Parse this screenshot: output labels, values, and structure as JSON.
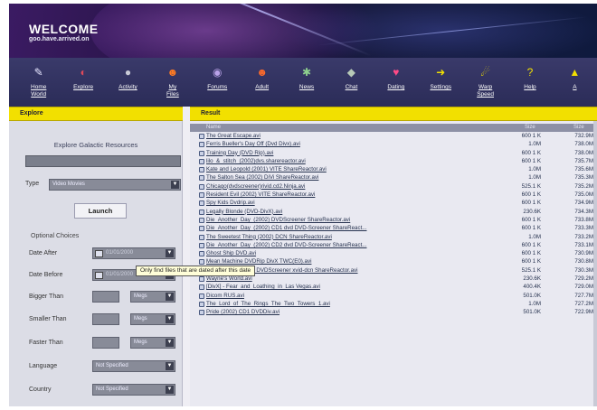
{
  "banner": {
    "welcome": "WELCOME",
    "subtitle": "goo.have.arrived.on"
  },
  "toolbar": [
    {
      "label": "Home\nWorld",
      "icon": "home-icon",
      "glyph": "✎",
      "color": "#e6e6ff"
    },
    {
      "label": "Explore",
      "icon": "explore-icon",
      "glyph": "◐",
      "color": "#e04a5a"
    },
    {
      "label": "Activity",
      "icon": "activity-icon",
      "glyph": "●",
      "color": "#c9cad6"
    },
    {
      "label": "My\nFiles",
      "icon": "my-files-icon",
      "glyph": "☻",
      "color": "#ff7a22"
    },
    {
      "label": "Forums",
      "icon": "forums-icon",
      "glyph": "◉",
      "color": "#b9a2e8"
    },
    {
      "label": "Adult",
      "icon": "adult-icon",
      "glyph": "☻",
      "color": "#ff6a2a"
    },
    {
      "label": "News",
      "icon": "news-icon",
      "glyph": "✱",
      "color": "#8ed08e"
    },
    {
      "label": "Chat",
      "icon": "chat-icon",
      "glyph": "◆",
      "color": "#b7c9b7"
    },
    {
      "label": "Dating",
      "icon": "dating-icon",
      "glyph": "♥",
      "color": "#ff4a86"
    },
    {
      "label": "Settings",
      "icon": "settings-icon",
      "glyph": "➜",
      "color": "#f2e000"
    },
    {
      "label": "Warp\nSpeed",
      "icon": "warp-speed-icon",
      "glyph": "☄",
      "color": "#f2e000"
    },
    {
      "label": "Help",
      "icon": "help-icon",
      "glyph": "?",
      "color": "#f2e000"
    },
    {
      "label": "A",
      "icon": "about-icon",
      "glyph": "▲",
      "color": "#f2e000"
    }
  ],
  "left_panel": {
    "header": "Explore",
    "title": "Explore Galactic Resources",
    "type_label": "Type",
    "type_value": "Video Movies",
    "launch_label": "Launch",
    "optional_title": "Optional Choices",
    "date_after_label": "Date After",
    "date_after_value": "01/01/2000",
    "date_before_label": "Date Before",
    "date_before_value": "01/01/2000",
    "bigger_label": "Bigger Than",
    "smaller_label": "Smaller Than",
    "faster_label": "Faster Than",
    "unit_value": "Megs",
    "language_label": "Language",
    "language_value": "Not Specified",
    "country_label": "Country",
    "country_value": "Not Specified",
    "tooltip": "Only find files that are dated after this date"
  },
  "result": {
    "header": "Result",
    "columns": [
      "Name",
      "Size",
      "Size"
    ],
    "rows": [
      {
        "name": "The Great Escape.avi",
        "size": "600 1 K",
        "size2": "732.9M"
      },
      {
        "name": "Ferris Bueller's Day Off (Dvd Divx).avi",
        "size": "1.0M",
        "size2": "738.0M"
      },
      {
        "name": "Training Day (DVD Rip).avi",
        "size": "600 1 K",
        "size2": "738.0M"
      },
      {
        "name": "lilo_&_stitch_(2002)dvs.sharereactor.avi",
        "size": "600 1 K",
        "size2": "735.7M"
      },
      {
        "name": "Kate and Leopold (2001) VITE ShareReactor.avi",
        "size": "1.0M",
        "size2": "735.6M"
      },
      {
        "name": "The Salton Sea (2002) DiVi ShareReactor.avi",
        "size": "1.0M",
        "size2": "735.3M"
      },
      {
        "name": "Chicago(dvdscreener)rivid.cd2.Ninja.avi",
        "size": "525.1 K",
        "size2": "735.2M"
      },
      {
        "name": "Resident Evil (2002) VITE ShareReactor.avi",
        "size": "600 1 K",
        "size2": "735.0M"
      },
      {
        "name": "Spy Kids Dvdrip.avi",
        "size": "600 1 K",
        "size2": "734.9M"
      },
      {
        "name": "Legally Blonde (DVD-DivX).avi",
        "size": "230.6K",
        "size2": "734.3M"
      },
      {
        "name": "Die_Another_Day_(2002) DVDScreener ShareReactor.avi",
        "size": "600 1 K",
        "size2": "733.8M"
      },
      {
        "name": "Die_Another_Day_(2002) CD1 dvd DVD-Screener ShareReact...",
        "size": "600 1 K",
        "size2": "733.3M"
      },
      {
        "name": "The Sweetest Thing (2002) DCN ShareReactor.avi",
        "size": "1.0M",
        "size2": "733.2M"
      },
      {
        "name": "Die_Another_Day_(2002) CD2 dvd DVD-Screener ShareReact...",
        "size": "600 1 K",
        "size2": "733.1M"
      },
      {
        "name": "Ghost Ship DVD.avi",
        "size": "600 1 K",
        "size2": "730.9M"
      },
      {
        "name": "Mean Machine DVDRip DivX TWC(E0).avi",
        "size": "600 1 K",
        "size2": "730.8M"
      },
      {
        "name": "Ghost_Ship_(2002) DVDScreener xvid-dcn ShareReactor.avi",
        "size": "525.1 K",
        "size2": "730.3M"
      },
      {
        "name": "Wayne's World.avi",
        "size": "230.6K",
        "size2": "729.2M"
      },
      {
        "name": "[DivX] - Fear_and_Loathing_in_Las Vegas.avi",
        "size": "400.4K",
        "size2": "729.0M"
      },
      {
        "name": "Dicom RUS.avi",
        "size": "501.0K",
        "size2": "727.7M"
      },
      {
        "name": "The_Lord_of_The_Rings_The_Two_Towers_1.avi",
        "size": "1.0M",
        "size2": "727.2M"
      },
      {
        "name": "Pride (2002) CD1 DVDDiv.avi",
        "size": "501.0K",
        "size2": "722.9M"
      }
    ]
  },
  "colors": {
    "accent": "#f2e000",
    "toolbar": "#2b2c58",
    "panel": "#dcdde6"
  }
}
